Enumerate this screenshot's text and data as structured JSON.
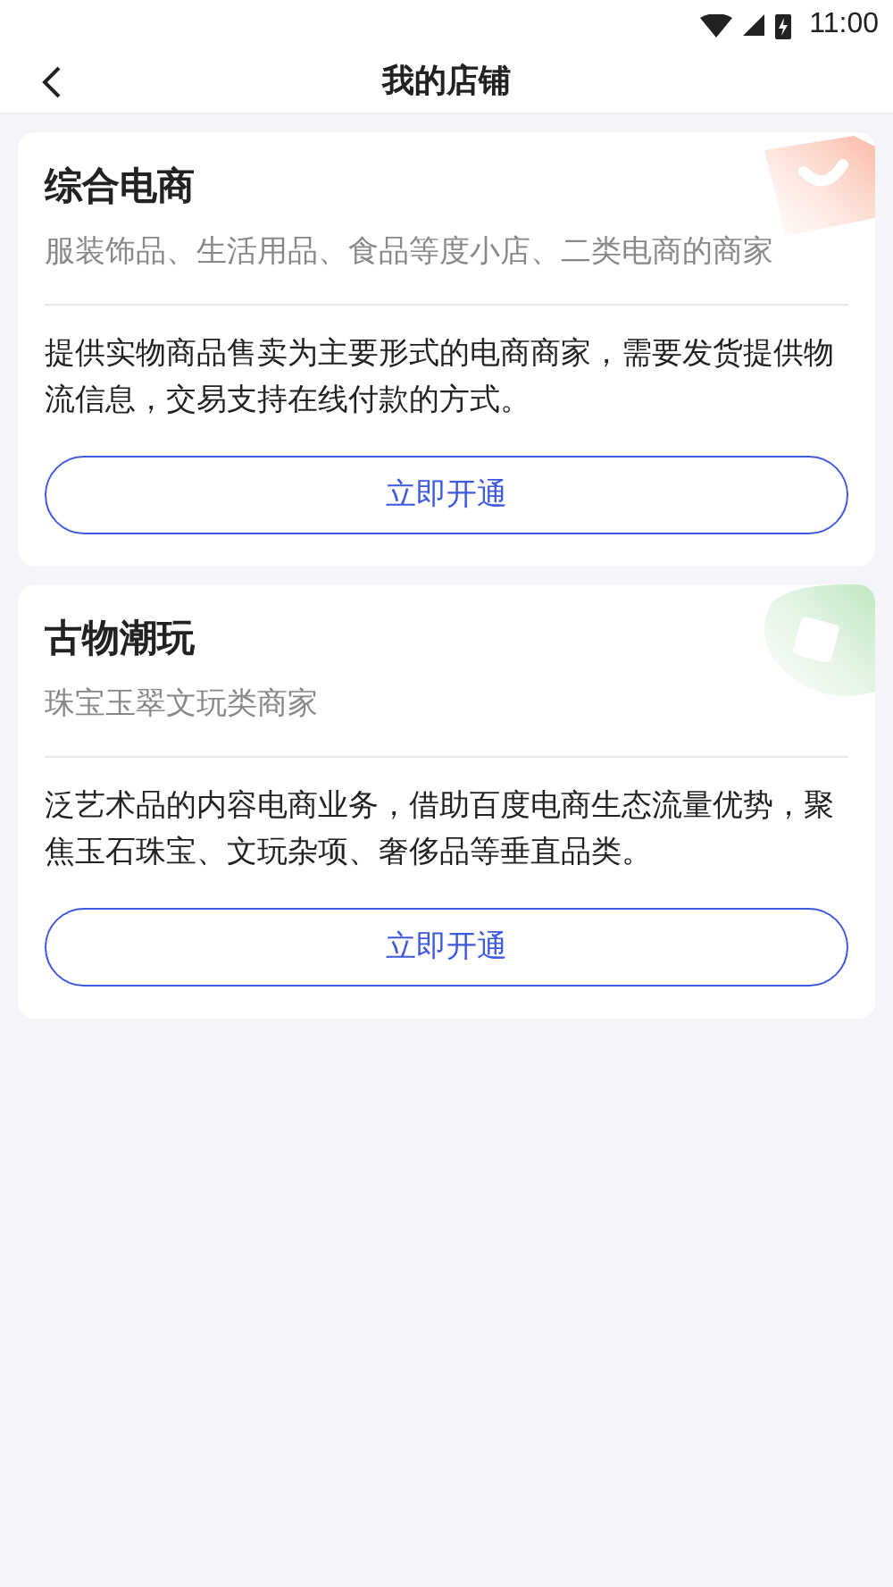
{
  "status_bar": {
    "time": "11:00"
  },
  "header": {
    "title": "我的店铺"
  },
  "cards": [
    {
      "kind": "bag",
      "title": "综合电商",
      "subtitle": "服装饰品、生活用品、食品等度小店、二类电商的商家",
      "description": "提供实物商品售卖为主要形式的电商商家，需要发货提供物流信息，交易支持在线付款的方式。",
      "button": "立即开通"
    },
    {
      "kind": "jade",
      "title": "古物潮玩",
      "subtitle": "珠宝玉翠文玩类商家",
      "description": "泛艺术品的内容电商业务，借助百度电商生态流量优势，聚焦玉石珠宝、文玩杂项、奢侈品等垂直品类。",
      "button": "立即开通"
    }
  ]
}
